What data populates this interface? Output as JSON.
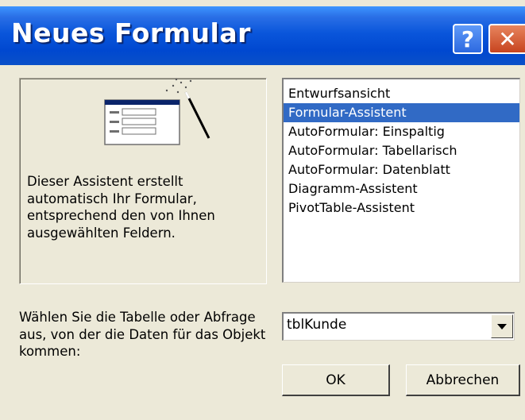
{
  "window": {
    "title": "Neues Formular",
    "help_glyph": "?",
    "close_glyph": "✕"
  },
  "wizard": {
    "graphic_icon": "form-wizard-icon",
    "description": "Dieser Assistent erstellt automatisch Ihr Formular, entsprechend den von Ihnen ausgewählten Feldern."
  },
  "form_types": {
    "selected_index": 1,
    "items": [
      {
        "label": "Entwurfsansicht"
      },
      {
        "label": "Formular-Assistent"
      },
      {
        "label": "AutoFormular:  Einspaltig"
      },
      {
        "label": "AutoFormular:  Tabellarisch"
      },
      {
        "label": "AutoFormular:  Datenblatt"
      },
      {
        "label": "Diagramm-Assistent"
      },
      {
        "label": "PivotTable-Assistent"
      }
    ]
  },
  "source": {
    "label": "Wählen Sie die Tabelle oder Abfrage aus, von der die Daten für das Objekt kommen:",
    "value": "tblKunde"
  },
  "buttons": {
    "ok": "OK",
    "cancel": "Abbrechen"
  },
  "colors": {
    "title_bar": "#0054e3",
    "selection": "#316ac5",
    "dialog_bg": "#ece9d8"
  }
}
